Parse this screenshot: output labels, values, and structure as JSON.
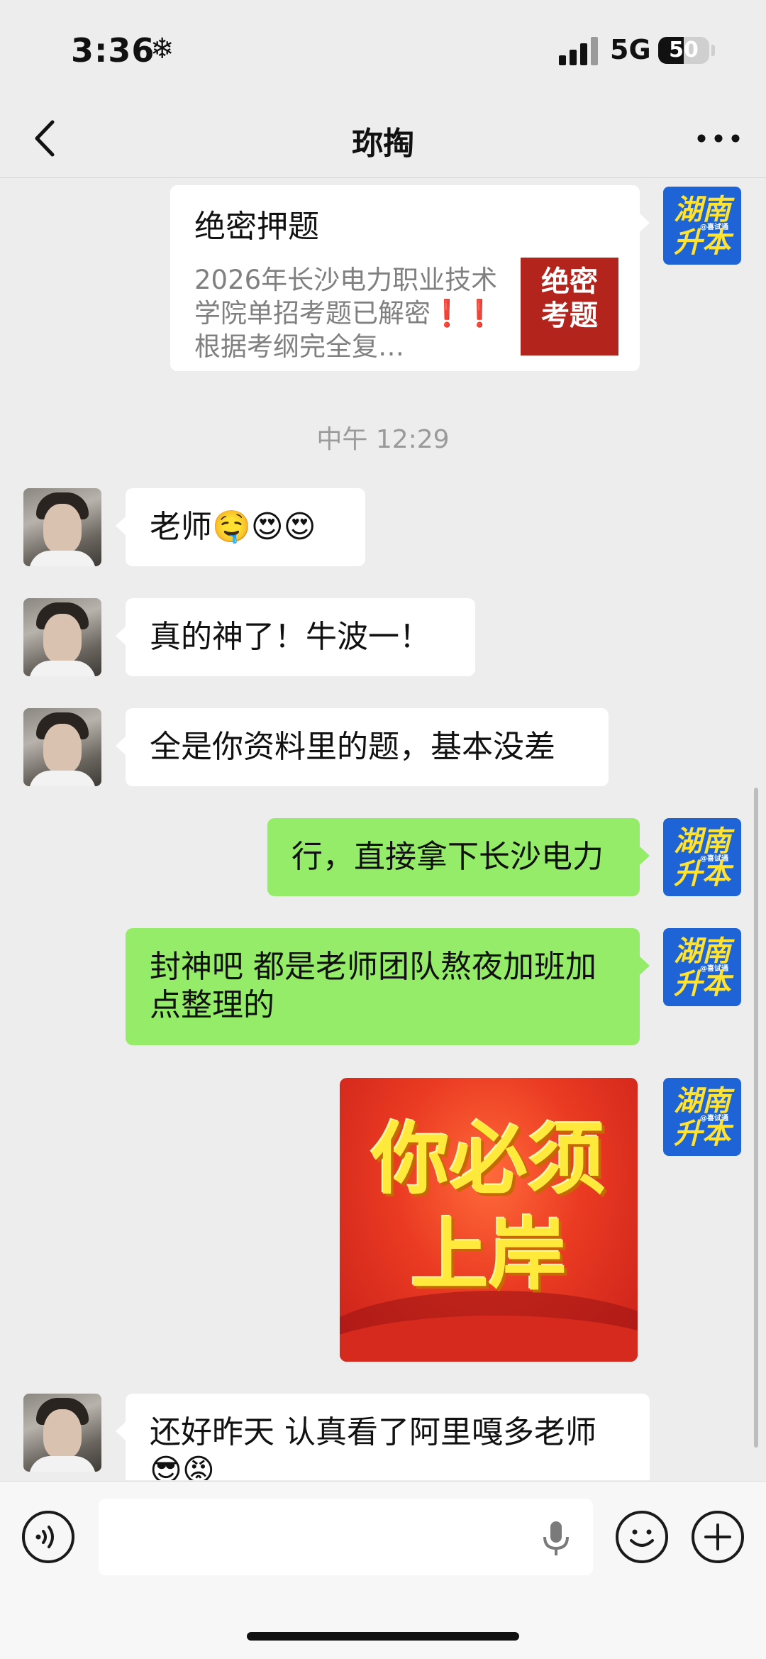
{
  "status_bar": {
    "time": "3:36",
    "weather_glyph": "❄",
    "network": "5G",
    "battery": "50",
    "battery_level": 0.5
  },
  "nav": {
    "title": "珎掏"
  },
  "messages": {
    "card": {
      "title": "绝密押题",
      "description": "2026年长沙电力职业技术学院单招考题已解密❗❗根据考纲完全复…",
      "thumb_line1": "绝密",
      "thumb_line2": "考题",
      "avatar_line1": "湖南",
      "avatar_line2": "升本"
    },
    "timestamp": "中午 12:29",
    "incoming": [
      {
        "text": "老师",
        "emoji": "🤤😍😍"
      },
      {
        "text": "真的神了！牛波一！"
      },
      {
        "text": "全是你资料里的题，基本没差"
      },
      {
        "text": "还好昨天 认真看了阿里嘎多老师",
        "emoji": "😎😡"
      }
    ],
    "outgoing": [
      {
        "text": "行，直接拿下长沙电力"
      },
      {
        "text": "封神吧 都是老师团队熬夜加班加点整理的"
      }
    ],
    "sticker": {
      "line1": "你必须",
      "line2": "上岸"
    }
  },
  "brand_avatar": {
    "line1": "湖南",
    "line2": "升本",
    "small": "@喜试通"
  },
  "colors": {
    "background": "#ededed",
    "outgoing_bubble": "#95ec69",
    "incoming_bubble": "#ffffff",
    "brand_avatar": "#1e64d6",
    "brand_text": "#ffe330"
  },
  "icons": [
    "back-icon",
    "more-icon",
    "voice-icon",
    "mic-icon",
    "emoji-icon",
    "plus-icon"
  ]
}
